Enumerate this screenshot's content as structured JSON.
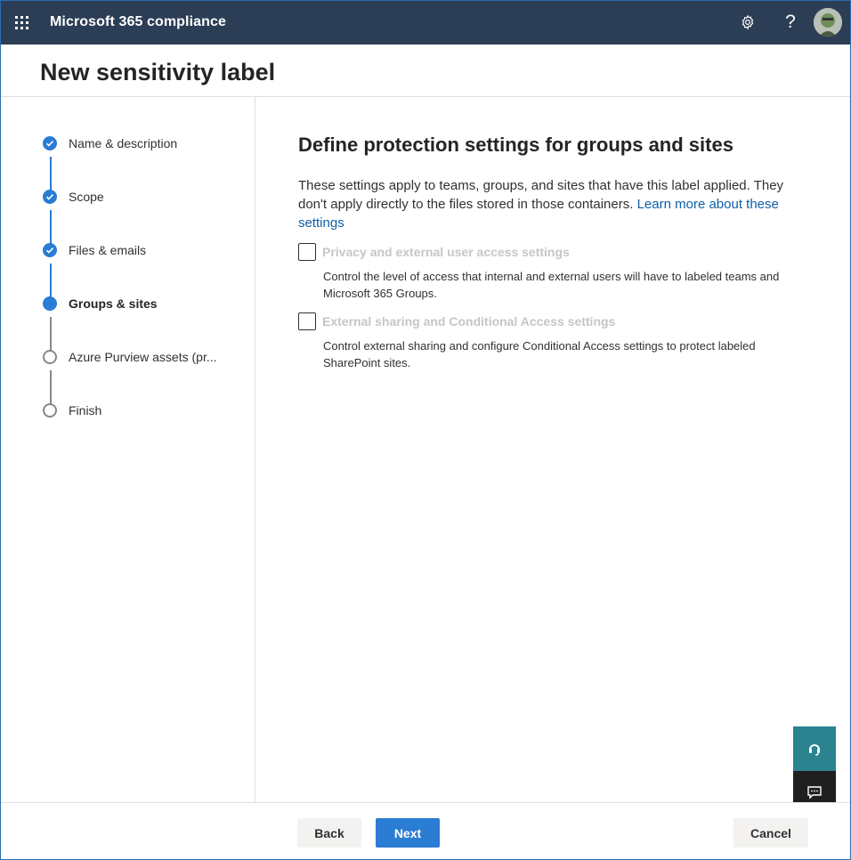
{
  "app": {
    "title": "Microsoft 365 compliance"
  },
  "topbar": {
    "icons": [
      "waffle-icon",
      "gear-icon",
      "help-icon",
      "avatar"
    ],
    "help_glyph": "?"
  },
  "header": {
    "title": "New sensitivity label"
  },
  "steps": [
    {
      "label": "Name & description",
      "state": "done"
    },
    {
      "label": "Scope",
      "state": "done"
    },
    {
      "label": "Files & emails",
      "state": "done"
    },
    {
      "label": "Groups & sites",
      "state": "current"
    },
    {
      "label": "Azure Purview assets (pr...",
      "state": "todo"
    },
    {
      "label": "Finish",
      "state": "todo"
    }
  ],
  "main": {
    "heading": "Define protection settings for groups and sites",
    "intro": "These settings apply to teams, groups, and sites that have this label applied. They don't apply directly to the files stored in those containers. ",
    "learn_more": "Learn more about these settings",
    "options": [
      {
        "title": "Privacy and external user access settings",
        "description": "Control the level of access that internal and external users will have to labeled teams and Microsoft 365 Groups.",
        "checked": false
      },
      {
        "title": "External sharing and Conditional Access settings",
        "description": "Control external sharing and configure Conditional Access settings to protect labeled SharePoint sites.",
        "checked": false
      }
    ]
  },
  "footer": {
    "back": "Back",
    "next": "Next",
    "cancel": "Cancel"
  },
  "colors": {
    "topbar": "#2c3e55",
    "accent": "#2b7cd3",
    "link": "#0f5fa8",
    "help_float": "#2a838f",
    "feedback_float": "#1f1f1f"
  }
}
